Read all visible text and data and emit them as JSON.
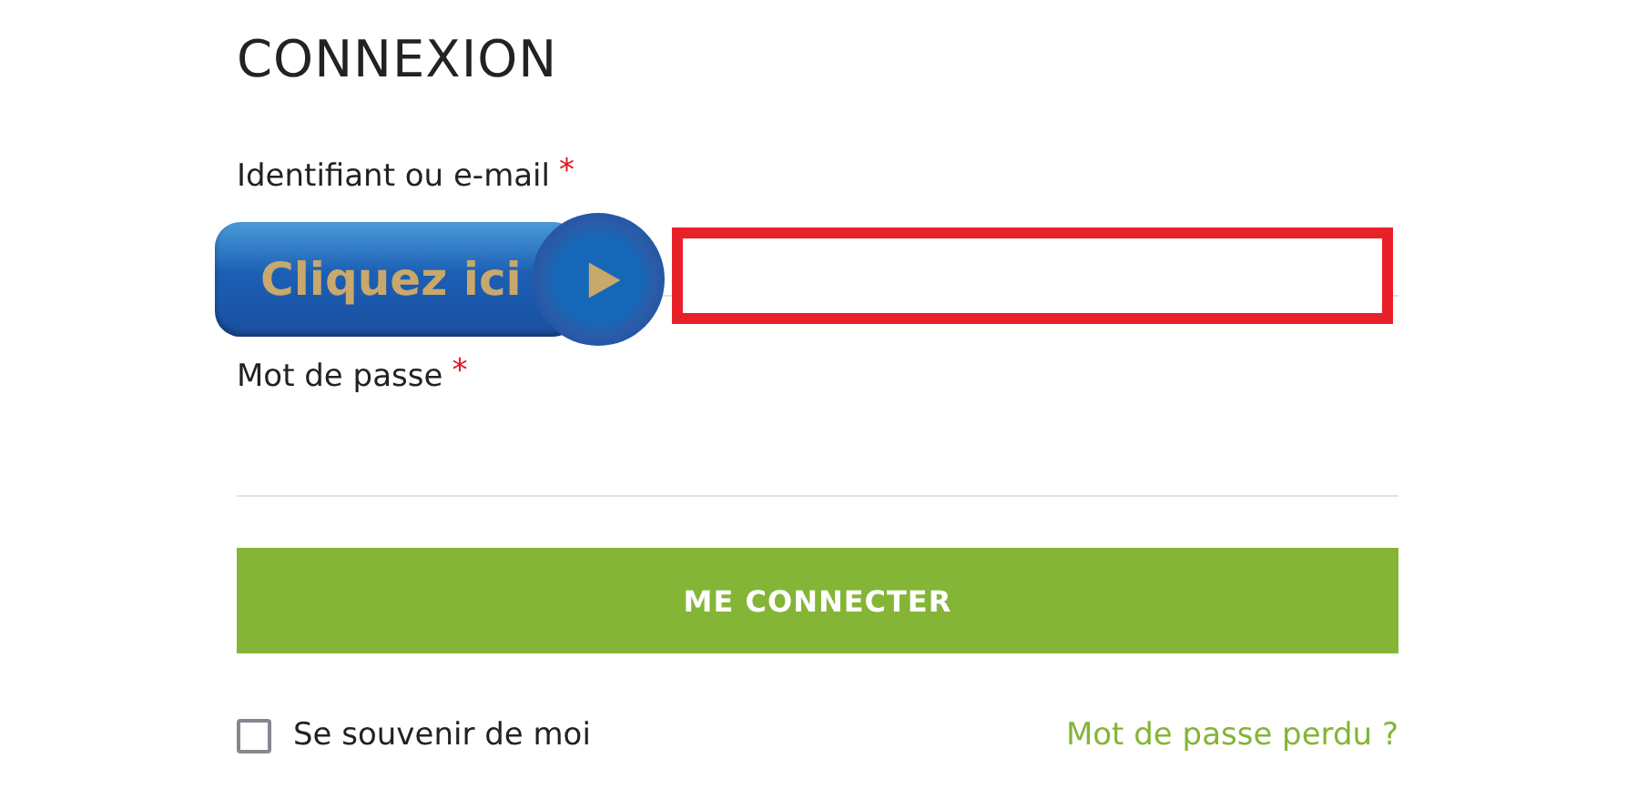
{
  "title": "CONNEXION",
  "fields": [
    {
      "label": "Identifiant ou e-mail",
      "required_mark": "*",
      "highlighted": true
    },
    {
      "label": "Mot de passe",
      "required_mark": "*",
      "highlighted": false
    }
  ],
  "submit_button": "ME CONNECTER",
  "remember": {
    "label": "Se souvenir de moi",
    "checked": false
  },
  "lost_password_link": "Mot de passe perdu ?",
  "callout": {
    "label": "Cliquez ici"
  }
}
